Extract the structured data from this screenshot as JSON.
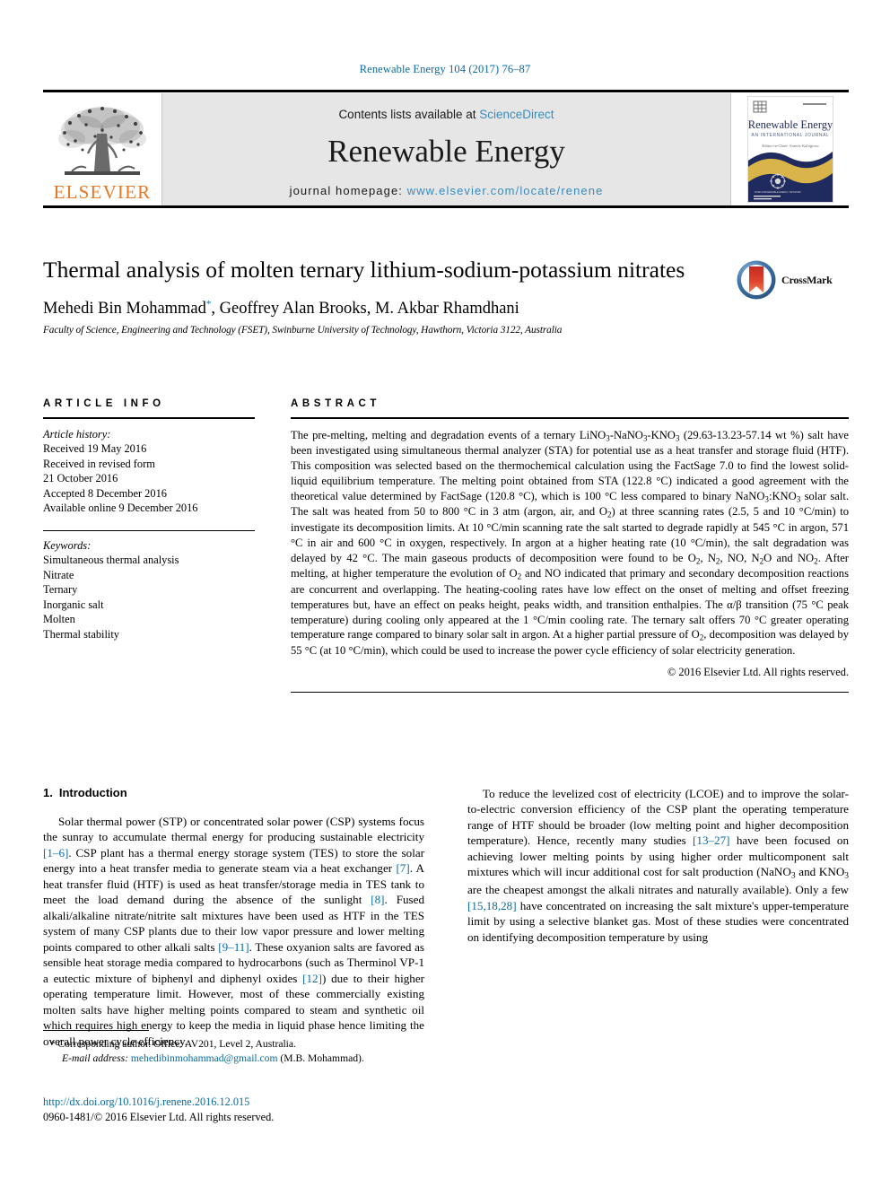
{
  "running_head": "Renewable Energy 104 (2017) 76–87",
  "header": {
    "contents_prefix": "Contents lists available at ",
    "sciencedirect": "ScienceDirect",
    "journal_title": "Renewable Energy",
    "homepage_prefix": "journal homepage: ",
    "homepage_url": "www.elsevier.com/locate/renene",
    "publisher_logo_text": "ELSEVIER",
    "cover_title": "Renewable Energy",
    "cover_subtitle": "AN INTERNATIONAL JOURNAL",
    "accent_blue": "#3a8bbb",
    "link_blue": "#0a6a9e",
    "elsevier_orange": "#e87722",
    "band_gray": "#e6e6e6",
    "cover_navy": "#1f2a5e",
    "cover_gold": "#d9b44a"
  },
  "article": {
    "title": "Thermal analysis of molten ternary lithium-sodium-potassium nitrates",
    "authors": "Mehedi Bin Mohammad, Geoffrey Alan Brooks, M. Akbar Rhamdhani",
    "corresponding_marker": "*",
    "affiliation": "Faculty of Science, Engineering and Technology (FSET), Swinburne University of Technology, Hawthorn, Victoria 3122, Australia",
    "crossmark_label": "CrossMark"
  },
  "article_info": {
    "heading": "ARTICLE INFO",
    "history_label": "Article history:",
    "history": [
      "Received 19 May 2016",
      "Received in revised form",
      "21 October 2016",
      "Accepted 8 December 2016",
      "Available online 9 December 2016"
    ],
    "keywords_label": "Keywords:",
    "keywords": [
      "Simultaneous thermal analysis",
      "Nitrate",
      "Ternary",
      "Inorganic salt",
      "Molten",
      "Thermal stability"
    ]
  },
  "abstract": {
    "heading": "ABSTRACT",
    "text": "The pre-melting, melting and degradation events of a ternary LiNO3-NaNO3-KNO3 (29.63-13.23-57.14 wt %) salt have been investigated using simultaneous thermal analyzer (STA) for potential use as a heat transfer and storage fluid (HTF). This composition was selected based on the thermochemical calculation using the FactSage 7.0 to find the lowest solid-liquid equilibrium temperature. The melting point obtained from STA (122.8 °C) indicated a good agreement with the theoretical value determined by FactSage (120.8 °C), which is 100 °C less compared to binary NaNO3:KNO3 solar salt. The salt was heated from 50 to 800 °C in 3 atm (argon, air, and O2) at three scanning rates (2.5, 5 and 10 °C/min) to investigate its decomposition limits. At 10 °C/min scanning rate the salt started to degrade rapidly at 545 °C in argon, 571 °C in air and 600 °C in oxygen, respectively. In argon at a higher heating rate (10 °C/min), the salt degradation was delayed by 42 °C. The main gaseous products of decomposition were found to be O2, N2, NO, N2O and NO2. After melting, at higher temperature the evolution of O2 and NO indicated that primary and secondary decomposition reactions are concurrent and overlapping. The heating-cooling rates have low effect on the onset of melting and offset freezing temperatures but, have an effect on peaks height, peaks width, and transition enthalpies. The α/β transition (75 °C peak temperature) during cooling only appeared at the 1 °C/min cooling rate. The ternary salt offers 70 °C greater operating temperature range compared to binary solar salt in argon. At a higher partial pressure of O2, decomposition was delayed by 55 °C (at 10 °C/min), which could be used to increase the power cycle efficiency of solar electricity generation.",
    "copyright": "© 2016 Elsevier Ltd. All rights reserved."
  },
  "introduction": {
    "number": "1.",
    "title": "Introduction",
    "para1": "Solar thermal power (STP) or concentrated solar power (CSP) systems focus the sunray to accumulate thermal energy for producing sustainable electricity [1–6]. CSP plant has a thermal energy storage system (TES) to store the solar energy into a heat transfer media to generate steam via a heat exchanger [7]. A heat transfer fluid (HTF) is used as heat transfer/storage media in TES tank to meet the load demand during the absence of the sunlight [8]. Fused alkali/alkaline nitrate/nitrite salt mixtures have been used as HTF in the TES system of many CSP plants due to their low vapor pressure and lower melting points compared to other alkali salts [9–11]. These oxyanion salts are favored as sensible heat storage media compared to hydrocarbons (such as Therminol VP-1 a eutectic mixture of biphenyl and diphenyl oxides [12]) due to their higher operating temperature limit. However, most of these commercially existing molten salts have higher melting points compared to steam and synthetic oil which requires high energy to keep the media in liquid phase hence limiting the overall power cycle efficiency.",
    "para2": "To reduce the levelized cost of electricity (LCOE) and to improve the solar-to-electric conversion efficiency of the CSP plant the operating temperature range of HTF should be broader (low melting point and higher decomposition temperature). Hence, recently many studies [13–27] have been focused on achieving lower melting points by using higher order multicomponent salt mixtures which will incur additional cost for salt production (NaNO3 and KNO3 are the cheapest amongst the alkali nitrates and naturally available). Only a few [15,18,28] have concentrated on increasing the salt mixture's upper-temperature limit by using a selective blanket gas. Most of these studies were concentrated on identifying decomposition temperature by using"
  },
  "footnote": {
    "marker": "*",
    "text": "Corresponding author. Office: AV201, Level 2, Australia.",
    "email_label": "E-mail address:",
    "email": "mehedibinmohammad@gmail.com",
    "email_owner": "(M.B. Mohammad)."
  },
  "footer": {
    "doi": "http://dx.doi.org/10.1016/j.renene.2016.12.015",
    "copyright": "0960-1481/© 2016 Elsevier Ltd. All rights reserved."
  }
}
